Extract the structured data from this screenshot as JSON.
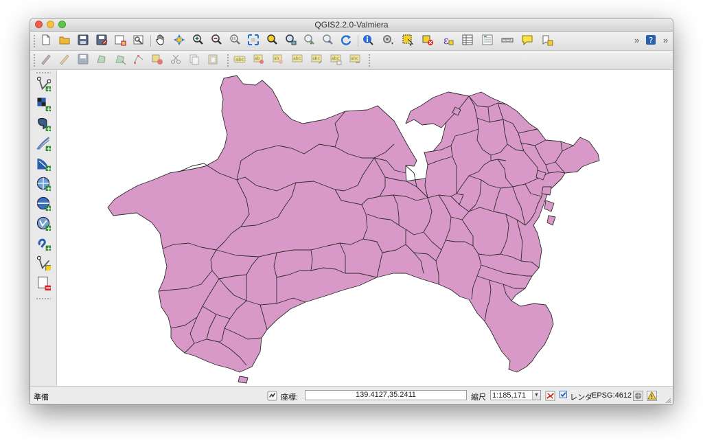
{
  "window": {
    "title": "QGIS2.2.0-Valmiera"
  },
  "toolbars": {
    "file": [
      {
        "icon": "new-project-icon"
      },
      {
        "icon": "open-project-icon"
      },
      {
        "icon": "save-project-icon"
      },
      {
        "icon": "save-project-as-icon"
      },
      {
        "icon": "new-print-composer-icon"
      },
      {
        "icon": "composer-manager-icon"
      }
    ],
    "navigation": [
      {
        "icon": "pan-hand-icon"
      },
      {
        "icon": "pan-to-selection-icon"
      },
      {
        "icon": "zoom-in-icon"
      },
      {
        "icon": "zoom-out-icon"
      },
      {
        "icon": "zoom-actual-size-icon"
      },
      {
        "icon": "zoom-full-icon"
      },
      {
        "icon": "zoom-to-selection-icon"
      },
      {
        "icon": "zoom-to-layer-icon"
      },
      {
        "icon": "zoom-last-icon"
      },
      {
        "icon": "zoom-next-icon"
      },
      {
        "icon": "refresh-icon"
      }
    ],
    "attributes": [
      {
        "icon": "identify-icon"
      },
      {
        "icon": "run-feature-action-icon"
      },
      {
        "icon": "select-features-icon"
      },
      {
        "icon": "deselect-all-icon"
      },
      {
        "icon": "field-calculator-icon"
      },
      {
        "icon": "attribute-table-icon"
      },
      {
        "icon": "statistics-icon"
      },
      {
        "icon": "measure-icon"
      },
      {
        "icon": "map-tips-icon"
      },
      {
        "icon": "new-bookmark-icon"
      }
    ],
    "overflow_glyph": "»",
    "help": {
      "icon": "help-icon"
    },
    "digitizing": [
      {
        "icon": "current-edits-icon"
      },
      {
        "icon": "toggle-editing-icon"
      },
      {
        "icon": "save-edits-icon"
      },
      {
        "icon": "add-feature-icon"
      },
      {
        "icon": "move-feature-icon"
      },
      {
        "icon": "node-tool-icon"
      },
      {
        "icon": "delete-selected-icon"
      },
      {
        "icon": "cut-features-icon"
      },
      {
        "icon": "copy-features-icon"
      },
      {
        "icon": "paste-features-icon"
      }
    ],
    "labels": [
      {
        "icon": "label-abc-icon"
      },
      {
        "icon": "pin-labels-icon"
      },
      {
        "icon": "highlight-pinned-labels-icon"
      },
      {
        "icon": "move-label-icon"
      },
      {
        "icon": "rotate-label-icon"
      },
      {
        "icon": "change-label-icon"
      },
      {
        "icon": "show-hide-labels-icon"
      }
    ]
  },
  "left_toolbar": [
    {
      "icon": "add-vector-layer-icon"
    },
    {
      "icon": "add-raster-layer-icon"
    },
    {
      "icon": "add-postgis-layer-icon"
    },
    {
      "icon": "add-spatialite-layer-icon"
    },
    {
      "icon": "add-mssql-layer-icon"
    },
    {
      "icon": "add-wms-layer-icon"
    },
    {
      "icon": "add-wcs-layer-icon"
    },
    {
      "icon": "add-wfs-layer-icon"
    },
    {
      "icon": "add-delimited-text-layer-icon"
    },
    {
      "icon": "new-shapefile-layer-icon"
    },
    {
      "icon": "remove-layer-icon"
    }
  ],
  "map": {
    "fill_color": "#d899c9",
    "stroke_color": "#2a2a2a",
    "background": "#ffffff"
  },
  "statusbar": {
    "ready": "準備",
    "coordinate_label": "座標:",
    "coordinate_value": "139.4127,35.2411",
    "scale_label": "縮尺",
    "scale_value": "1:185,171",
    "render_label": "レンダ",
    "render_checked": true,
    "crs": "EPSG:4612"
  }
}
